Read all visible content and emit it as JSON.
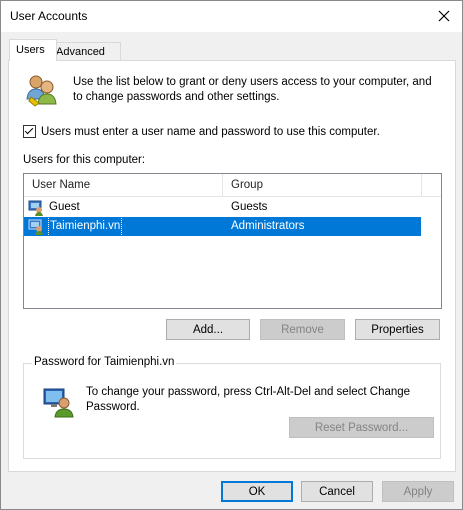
{
  "window": {
    "title": "User Accounts"
  },
  "tabs": [
    {
      "label": "Users"
    },
    {
      "label": "Advanced"
    }
  ],
  "intro": {
    "text": "Use the list below to grant or deny users access to your computer, and to change passwords and other settings."
  },
  "checkbox": {
    "label": "Users must enter a user name and password to use this computer.",
    "checked": true
  },
  "users_section": {
    "label": "Users for this computer:"
  },
  "listview": {
    "columns": [
      "User Name",
      "Group"
    ],
    "rows": [
      {
        "name": "Guest",
        "group": "Guests",
        "selected": false
      },
      {
        "name": "Taimienphi.vn",
        "group": "Administrators",
        "selected": true
      }
    ]
  },
  "list_buttons": {
    "add": "Add...",
    "remove": "Remove",
    "properties": "Properties"
  },
  "password_group": {
    "title": "Password for Taimienphi.vn",
    "text": "To change your password, press Ctrl-Alt-Del and select Change Password.",
    "reset_button": "Reset Password..."
  },
  "dialog_buttons": {
    "ok": "OK",
    "cancel": "Cancel",
    "apply": "Apply"
  },
  "colors": {
    "selection": "#0078d7",
    "disabled_text": "#838383"
  }
}
